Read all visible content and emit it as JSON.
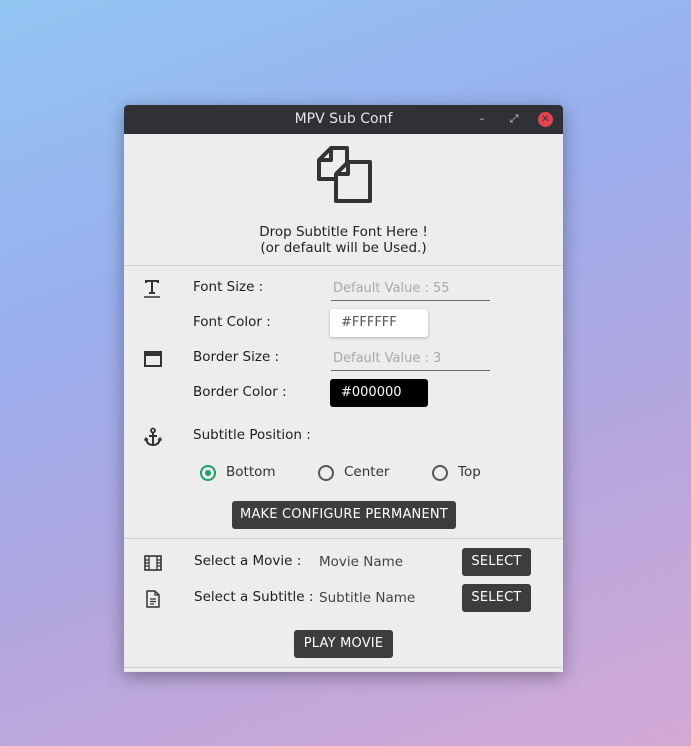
{
  "window": {
    "title": "MPV Sub Conf",
    "controls": {
      "minimize": "–",
      "maximize": "⤢",
      "close": "✕"
    }
  },
  "drop_area": {
    "icon": "copy-files-icon",
    "line1": "Drop Subtitle Font Here !",
    "line2": "(or default will be Used.)"
  },
  "font": {
    "icon": "text-size-icon",
    "size_label": "Font Size :",
    "size_placeholder": "Default Value : 55",
    "size_value": "",
    "color_label": "Font Color :",
    "color_value": "#FFFFFF"
  },
  "border": {
    "icon": "border-box-icon",
    "size_label": "Border Size :",
    "size_placeholder": "Default Value : 3",
    "size_value": "",
    "color_label": "Border Color :",
    "color_value": "#000000"
  },
  "position": {
    "icon": "anchor-icon",
    "label": "Subtitle Position :",
    "options": [
      "Bottom",
      "Center",
      "Top"
    ],
    "selected": "Bottom"
  },
  "make_permanent_button": "MAKE CONFIGURE PERMANENT",
  "movie": {
    "icon": "film-icon",
    "label": "Select a Movie :",
    "value": "Movie Name",
    "button": "SELECT"
  },
  "subtitle": {
    "icon": "document-icon",
    "label": "Select a Subtitle :",
    "value": "Subtitle Name",
    "button": "SELECT"
  },
  "play_button": "PLAY MOVIE",
  "colors": {
    "titlebar": "#2f3136",
    "window_bg": "#ededed",
    "close": "#e1454f",
    "radio_accent": "#1e9e68",
    "button_bg": "#3d3d3d"
  }
}
